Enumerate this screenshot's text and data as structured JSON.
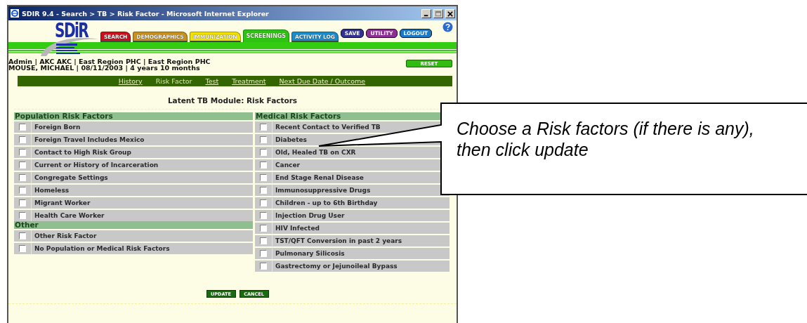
{
  "window": {
    "title": "SDIR 9.4 - Search > TB > Risk Factor - Microsoft Internet Explorer"
  },
  "logo": {
    "text": "SDiR"
  },
  "tabs": [
    {
      "label": "SEARCH",
      "kind": "tab",
      "color": "#cc1020",
      "selected": false
    },
    {
      "label": "DEMOGRAPHICS",
      "kind": "tab",
      "color": "#c8901c",
      "selected": false
    },
    {
      "label": "IMMUNIZATION",
      "kind": "tab",
      "color": "#f2e200",
      "selected": false
    },
    {
      "label": "SCREENINGS",
      "kind": "tab",
      "color": "#2ec212",
      "selected": true
    },
    {
      "label": "ACTIVITY LOG",
      "kind": "tab",
      "color": "#1a8ccc",
      "selected": false
    },
    {
      "label": "SAVE",
      "kind": "button",
      "color": "#33338f",
      "selected": false
    },
    {
      "label": "UTILITY",
      "kind": "button",
      "color": "#8e2f96",
      "selected": false
    },
    {
      "label": "LOGOUT",
      "kind": "button",
      "color": "#1a7ac8",
      "selected": false
    }
  ],
  "user_info": [
    "Admin | AKC AKC | East Region PHC | East Region PHC",
    "MOUSE, MICHAEL | 08/11/2003 | 4 years 10 months"
  ],
  "reset_button": "RESET",
  "nav_links": [
    {
      "label": "History",
      "selected": false
    },
    {
      "label": "Risk Factor",
      "selected": true
    },
    {
      "label": "Test",
      "selected": false
    },
    {
      "label": "Treatment",
      "selected": false
    },
    {
      "label": "Next Due Date / Outcome",
      "selected": false
    }
  ],
  "page_title": "Latent TB Module: Risk Factors",
  "left_sections": [
    {
      "heading": "Population Risk Factors",
      "items": [
        {
          "label": "Foreign Born",
          "checked": false
        },
        {
          "label": "Foreign Travel Includes Mexico",
          "checked": false
        },
        {
          "label": "Contact to High Risk Group",
          "checked": false
        },
        {
          "label": "Current or History of Incarceration",
          "checked": false
        },
        {
          "label": "Congregate Settings",
          "checked": false
        },
        {
          "label": "Homeless",
          "checked": false
        },
        {
          "label": "Migrant Worker",
          "checked": false
        },
        {
          "label": "Health Care Worker",
          "checked": false
        }
      ]
    },
    {
      "heading": "Other",
      "items": [
        {
          "label": "Other Risk Factor",
          "checked": false
        },
        {
          "label": "No Population or Medical Risk Factors",
          "checked": false
        }
      ]
    }
  ],
  "right_sections": [
    {
      "heading": "Medical Risk Factors",
      "items": [
        {
          "label": "Recent Contact to Verified TB",
          "checked": false
        },
        {
          "label": "Diabetes",
          "checked": false
        },
        {
          "label": "Old, Healed TB on CXR",
          "checked": false
        },
        {
          "label": "Cancer",
          "checked": false
        },
        {
          "label": "End Stage Renal Disease",
          "checked": false
        },
        {
          "label": "Immunosuppressive Drugs",
          "checked": false
        },
        {
          "label": "Children - up to 6th Birthday",
          "checked": false
        },
        {
          "label": "Injection Drug User",
          "checked": false
        },
        {
          "label": "HIV Infected",
          "checked": false
        },
        {
          "label": "TST/QFT Conversion in past 2 years",
          "checked": false
        },
        {
          "label": "Pulmonary Silicosis",
          "checked": false
        },
        {
          "label": "Gastrectomy or Jejunoileal Bypass",
          "checked": false
        }
      ]
    }
  ],
  "buttons": [
    "UPDATE",
    "CANCEL"
  ],
  "callout": {
    "text": "Choose a Risk factors (if there is any), then click update"
  }
}
